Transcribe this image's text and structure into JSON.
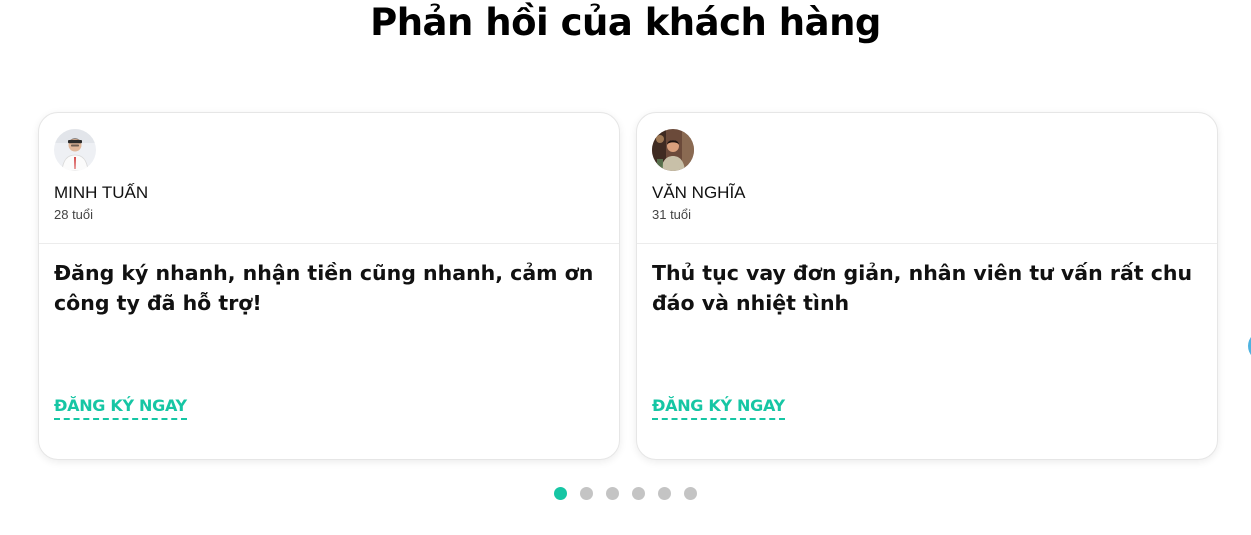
{
  "section": {
    "title": "Phản hồi của khách hàng"
  },
  "testimonials": [
    {
      "name": "MINH TUẤN",
      "age": "28 tuổi",
      "quote": "Đăng ký nhanh, nhận tiền cũng nhanh, cảm ơn công ty đã hỗ trợ!",
      "cta": "ĐĂNG KÝ NGAY",
      "avatar_icon": "person-photo-icon"
    },
    {
      "name": "VĂN NGHĨA",
      "age": "31 tuổi",
      "quote": "Thủ tục vay đơn giản, nhân viên tư vấn rất chu đáo và nhiệt tình",
      "cta": "ĐĂNG KÝ NGAY",
      "avatar_icon": "person-photo-icon"
    }
  ],
  "pagination": {
    "total": 6,
    "active_index": 0
  },
  "colors": {
    "accent": "#16c6a4",
    "dot_inactive": "#c4c4c4",
    "arrow": "#4fb3e0"
  }
}
